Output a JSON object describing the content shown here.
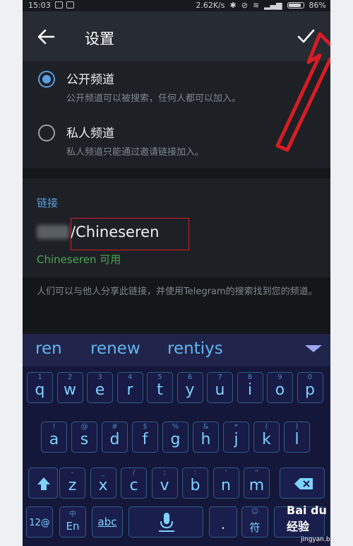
{
  "status_bar": {
    "time": "15:03",
    "speed": "2.62K/s",
    "battery": "86%"
  },
  "app_bar": {
    "title": "设置"
  },
  "channel_type": {
    "options": [
      {
        "title": "公开频道",
        "description": "公开频道可以被搜索，任何人都可以加入。",
        "selected": true
      },
      {
        "title": "私人频道",
        "description": "私人频道只能通过邀请链接加入。",
        "selected": false
      }
    ]
  },
  "link": {
    "header": "链接",
    "value": "/Chineseren",
    "availability": "Chineseren 可用",
    "info": "人们可以与他人分享此链接，并使用Telegram的搜索找到您的频道。"
  },
  "keyboard": {
    "suggestions": [
      "ren",
      "renew",
      "rentiys"
    ],
    "row1": [
      [
        "q",
        "1"
      ],
      [
        "w",
        "2"
      ],
      [
        "e",
        "3"
      ],
      [
        "r",
        "4"
      ],
      [
        "t",
        "5"
      ],
      [
        "y",
        "6"
      ],
      [
        "u",
        "7"
      ],
      [
        "i",
        "8"
      ],
      [
        "o",
        "9"
      ],
      [
        "p",
        "0"
      ]
    ],
    "row2": [
      [
        "a",
        "!"
      ],
      [
        "s",
        "@"
      ],
      [
        "d",
        "#"
      ],
      [
        "f",
        "$"
      ],
      [
        "g",
        "%"
      ],
      [
        "h",
        "&"
      ],
      [
        "j",
        "*"
      ],
      [
        "k",
        "("
      ],
      [
        "l",
        ")"
      ]
    ],
    "row3": [
      [
        "z",
        "-"
      ],
      [
        "x",
        "_"
      ],
      [
        "c",
        "/"
      ],
      [
        "v",
        ";"
      ],
      [
        "b",
        ":"
      ],
      [
        "n",
        "'"
      ],
      [
        "m",
        "\""
      ]
    ],
    "bottom": {
      "num_label": "12@",
      "lang_hint": "中",
      "lang_label": "En",
      "abc_label": "abc",
      "sym_hint": "☺",
      "sym_label": "符",
      "period": "."
    }
  },
  "colors": {
    "accent": "#5a9fe0",
    "available": "#4ba550",
    "key_text": "#7cd3ff",
    "annotation_red": "#d81c24"
  },
  "watermark": {
    "text": "Bai du 经验",
    "url": "jingyan.baidu.com"
  }
}
